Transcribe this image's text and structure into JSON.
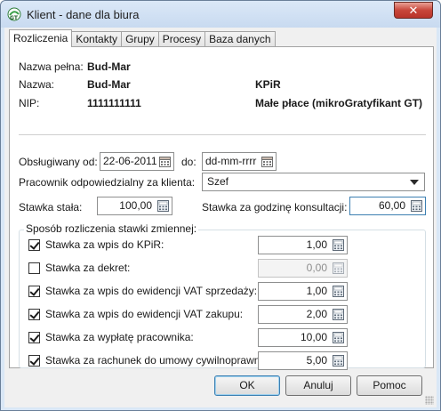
{
  "window": {
    "title": "Klient - dane dla biura",
    "close_symbol": "✕"
  },
  "tabs": [
    "Rozliczenia",
    "Kontakty",
    "Grupy",
    "Procesy",
    "Baza danych"
  ],
  "info": {
    "full_name_label": "Nazwa pełna:",
    "full_name": "Bud-Mar",
    "name_label": "Nazwa:",
    "name": "Bud-Mar",
    "type": "KPiR",
    "nip_label": "NIP:",
    "nip": "1111111111",
    "program": "Małe płace (mikroGratyfikant GT)"
  },
  "service": {
    "from_label": "Obsługiwany od:",
    "from_value": "22-06-2011",
    "to_label": "do:",
    "to_value": "dd-mm-rrrr"
  },
  "employee": {
    "label": "Pracownik odpowiedzialny za klienta:",
    "value": "Szef"
  },
  "rates": {
    "fixed_label": "Stawka stała:",
    "fixed_value": "100,00",
    "hourly_label": "Stawka za godzinę konsultacji:",
    "hourly_value": "60,00"
  },
  "variable": {
    "legend": "Sposób rozliczenia stawki zmiennej:",
    "items": [
      {
        "label": "Stawka za wpis do KPiR:",
        "checked": true,
        "value": "1,00",
        "enabled": true
      },
      {
        "label": "Stawka za dekret:",
        "checked": false,
        "value": "0,00",
        "enabled": false
      },
      {
        "label": "Stawka za wpis do ewidencji VAT sprzedaży:",
        "checked": true,
        "value": "1,00",
        "enabled": true
      },
      {
        "label": "Stawka za wpis do ewidencji VAT zakupu:",
        "checked": true,
        "value": "2,00",
        "enabled": true
      },
      {
        "label": "Stawka za wypłatę pracownika:",
        "checked": true,
        "value": "10,00",
        "enabled": true
      },
      {
        "label": "Stawka za rachunek do umowy cywilnoprawnej:",
        "checked": true,
        "value": "5,00",
        "enabled": true
      }
    ]
  },
  "buttons": {
    "ok": "OK",
    "cancel": "Anuluj",
    "help": "Pomoc"
  },
  "icons": {
    "app": "gt-app-icon",
    "calendar": "calendar-icon",
    "calculator": "calculator-icon"
  },
  "colors": {
    "title_bg": "#c8daf0",
    "close_red": "#c8463a",
    "focus_border": "#3c7fb1"
  }
}
